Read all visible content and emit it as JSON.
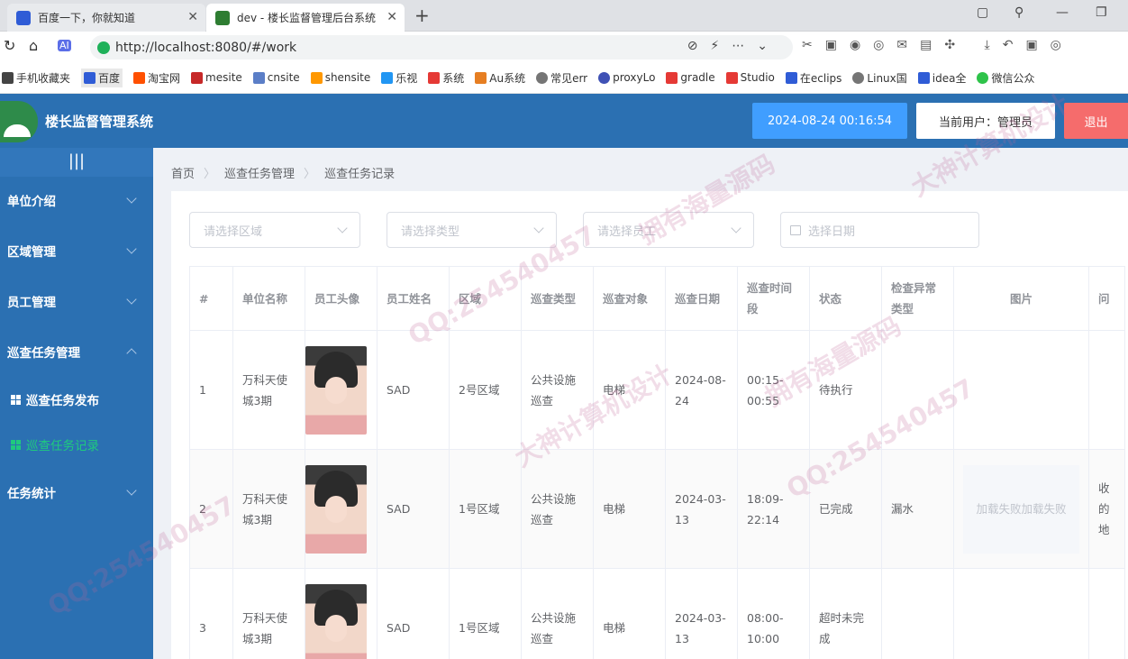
{
  "browser": {
    "tabs": [
      {
        "title": "百度一下，你就知道",
        "color": "#2f5cd6"
      },
      {
        "title": "dev - 楼长监督管理后台系统",
        "color": "#2e7d32"
      }
    ],
    "url": "http://localhost:8080/#/work",
    "bookmarks": [
      {
        "label": "手机收藏夹",
        "color": "#444444"
      },
      {
        "label": "百度",
        "color": "#2f5cd6"
      },
      {
        "label": "淘宝网",
        "color": "#ff5000"
      },
      {
        "label": "mesite",
        "color": "#c62828"
      },
      {
        "label": "cnsite",
        "color": "#5b7ec7"
      },
      {
        "label": "shensite",
        "color": "#ff9800"
      },
      {
        "label": "乐视",
        "color": "#2196f3"
      },
      {
        "label": "系统",
        "color": "#e53935"
      },
      {
        "label": "Au系统",
        "color": "#e67e22"
      },
      {
        "label": "常见err",
        "color": "#757575"
      },
      {
        "label": "proxyLo",
        "color": "#3f51b5"
      },
      {
        "label": "gradle",
        "color": "#e53935"
      },
      {
        "label": "Studio",
        "color": "#e53935"
      },
      {
        "label": "在eclips",
        "color": "#2f5cd6"
      },
      {
        "label": "Linux国",
        "color": "#757575"
      },
      {
        "label": "idea全",
        "color": "#2f5cd6"
      },
      {
        "label": "微信公众",
        "color": "#2ec34a"
      }
    ]
  },
  "header": {
    "system_name": "楼长监督管理系统",
    "datetime": "2024-08-24 00:16:54",
    "current_user": "当前用户：管理员",
    "logout_label": "退出"
  },
  "sidebar": {
    "toggle": "|||",
    "menus": [
      {
        "label": "单位介绍",
        "expanded": false
      },
      {
        "label": "区域管理",
        "expanded": false
      },
      {
        "label": "员工管理",
        "expanded": false
      },
      {
        "label": "巡查任务管理",
        "expanded": true
      },
      {
        "label": "任务统计",
        "expanded": false
      }
    ],
    "submenus": [
      {
        "label": "巡查任务发布",
        "active": false
      },
      {
        "label": "巡查任务记录",
        "active": true
      }
    ]
  },
  "breadcrumb": [
    "首页",
    "巡查任务管理",
    "巡查任务记录"
  ],
  "filters": {
    "area_placeholder": "请选择区域",
    "type_placeholder": "请选择类型",
    "employee_placeholder": "请选择员工",
    "date_placeholder": "选择日期"
  },
  "table": {
    "columns": [
      "#",
      "单位名称",
      "员工头像",
      "员工姓名",
      "区域",
      "巡查类型",
      "巡查对象",
      "巡查日期",
      "巡查时间段",
      "状态",
      "检查异常类型",
      "图片",
      "问"
    ],
    "rows": [
      {
        "index": "1",
        "unit": "万科天使城3期",
        "name": "SAD",
        "area": "2号区域",
        "type": "公共设施巡查",
        "object": "电梯",
        "date": "2024-08-24",
        "period": "00:15-00:55",
        "status": "待执行",
        "abnormal": "",
        "image": "",
        "extra": ""
      },
      {
        "index": "2",
        "unit": "万科天使城3期",
        "name": "SAD",
        "area": "1号区域",
        "type": "公共设施巡查",
        "object": "电梯",
        "date": "2024-03-13",
        "period": "18:09-22:14",
        "status": "已完成",
        "abnormal": "漏水",
        "image": "加载失败加载失败",
        "extra": "收的地"
      },
      {
        "index": "3",
        "unit": "万科天使城3期",
        "name": "SAD",
        "area": "1号区域",
        "type": "公共设施巡查",
        "object": "电梯",
        "date": "2024-03-13",
        "period": "08:00-10:00",
        "status": "超时未完成",
        "abnormal": "",
        "image": "",
        "extra": ""
      }
    ]
  },
  "watermarks": [
    "QQ:254540457",
    "大神计算机设计",
    "拥有海量源码"
  ]
}
